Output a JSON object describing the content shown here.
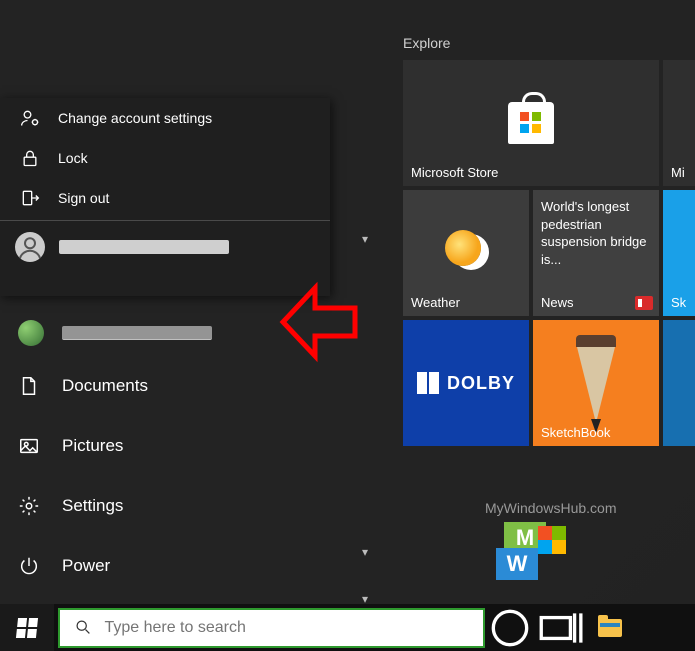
{
  "account_menu": {
    "change_settings": "Change account settings",
    "lock": "Lock",
    "sign_out": "Sign out",
    "other_user": "█████████@██████"
  },
  "rail": {
    "user_name": "██████████████",
    "documents": "Documents",
    "pictures": "Pictures",
    "settings": "Settings",
    "power": "Power"
  },
  "tiles": {
    "heading": "Explore",
    "store": "Microsoft Store",
    "store_cut": "Mi",
    "weather": "Weather",
    "news_headline": "World's longest pedestrian suspension bridge is...",
    "news": "News",
    "sky": "Sk",
    "dolby_text": "DOLBY",
    "sketchbook": "SketchBook"
  },
  "taskbar": {
    "search_placeholder": "Type here to search"
  },
  "watermark": {
    "text": "MyWindowsHub.com"
  }
}
